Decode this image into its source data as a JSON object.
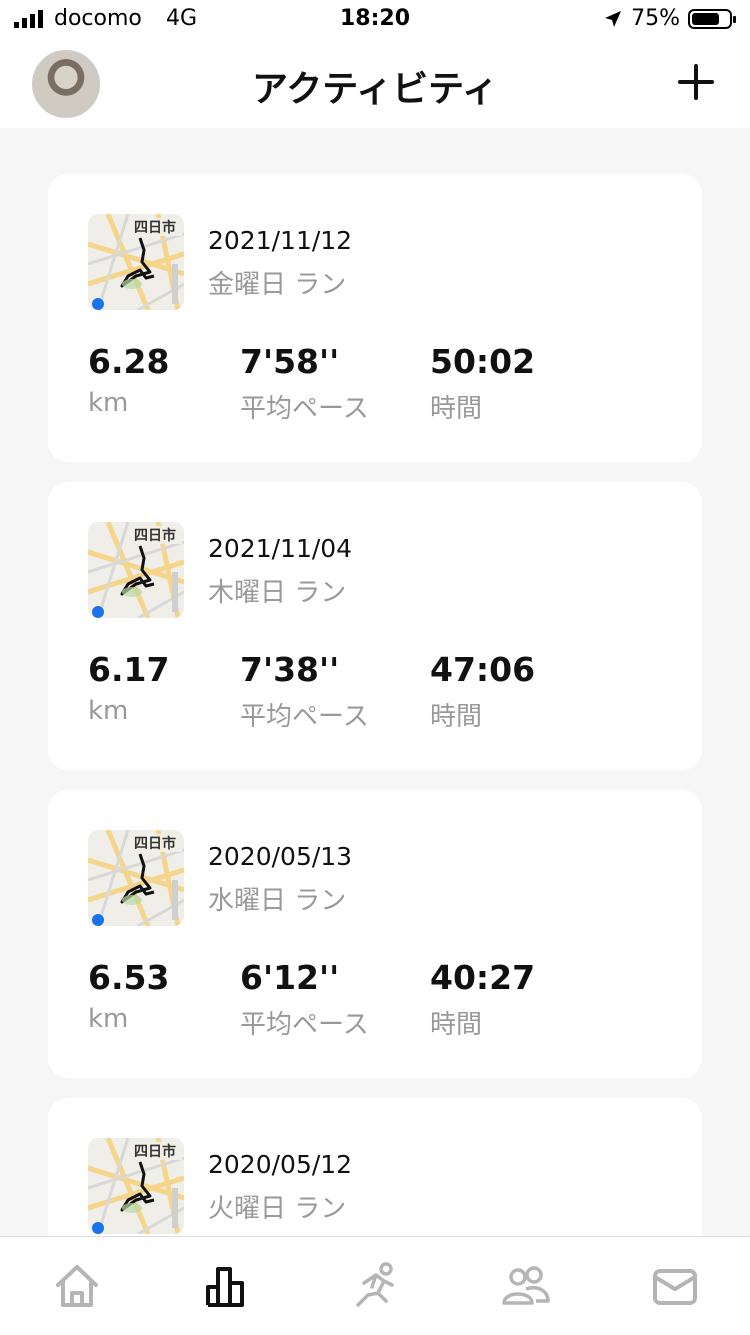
{
  "status_bar": {
    "carrier": "docomo",
    "network": "4G",
    "time": "18:20",
    "battery": "75%",
    "battery_level": 0.75
  },
  "header": {
    "title": "アクティビティ",
    "avatar_icon": "avatar",
    "add_icon": "plus-icon"
  },
  "map_label": "四日市",
  "activities": [
    {
      "date": "2021/11/12",
      "subtitle": "金曜日 ラン",
      "distance": "6.28",
      "distance_unit": "km",
      "pace": "7'58''",
      "pace_label": "平均ペース",
      "duration": "50:02",
      "duration_label": "時間"
    },
    {
      "date": "2021/11/04",
      "subtitle": "木曜日 ラン",
      "distance": "6.17",
      "distance_unit": "km",
      "pace": "7'38''",
      "pace_label": "平均ペース",
      "duration": "47:06",
      "duration_label": "時間"
    },
    {
      "date": "2020/05/13",
      "subtitle": "水曜日 ラン",
      "distance": "6.53",
      "distance_unit": "km",
      "pace": "6'12''",
      "pace_label": "平均ペース",
      "duration": "40:27",
      "duration_label": "時間"
    },
    {
      "date": "2020/05/12",
      "subtitle": "火曜日 ラン",
      "distance": "",
      "distance_unit": "",
      "pace": "",
      "pace_label": "",
      "duration": "",
      "duration_label": ""
    }
  ],
  "tabbar": {
    "items": [
      {
        "icon": "home-icon",
        "active": false
      },
      {
        "icon": "activity-chart-icon",
        "active": true
      },
      {
        "icon": "run-icon",
        "active": false
      },
      {
        "icon": "friends-icon",
        "active": false
      },
      {
        "icon": "mail-icon",
        "active": false
      }
    ],
    "active_color": "#111111",
    "inactive_color": "#b5b5b5"
  }
}
